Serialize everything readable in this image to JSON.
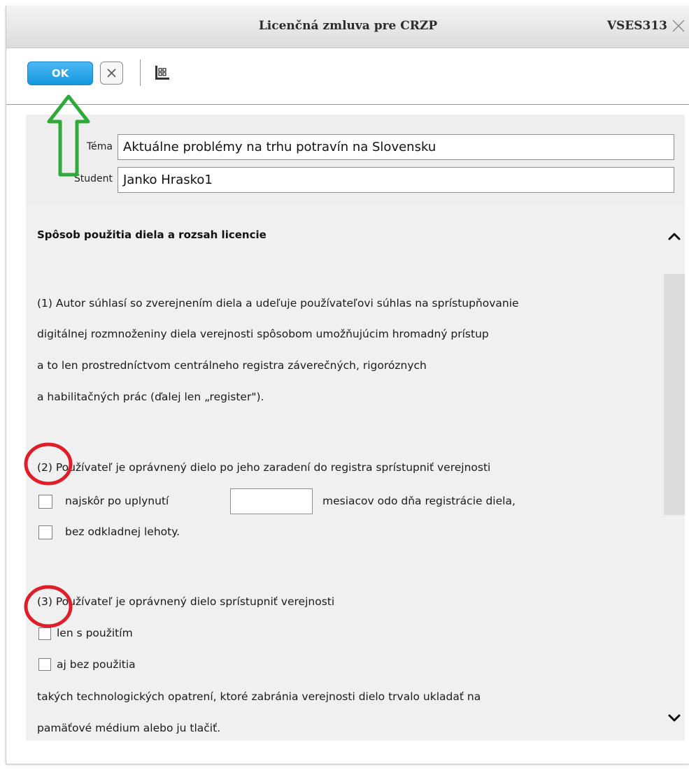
{
  "window": {
    "title": "Licenčná zmluva pre CRZP",
    "code": "VSES313",
    "close_icon": "close-icon"
  },
  "toolbar": {
    "ok_label": "OK",
    "cancel_icon": "close-icon",
    "grid_icon": "grid-icon"
  },
  "info": {
    "topic_label": "Téma",
    "topic_value": "Aktuálne problémy na trhu potravín na Slovensku",
    "student_label": "Študent",
    "student_value": "Janko Hrasko1"
  },
  "document": {
    "heading": "Spôsob použitia diela a rozsah licencie",
    "p1_lines": [
      "(1) Autor súhlasí so zverejnením diela a udeľuje používateľovi súhlas na sprístupňovanie",
      "digitálnej rozmnoženiny diela verejnosti spôsobom umožňujúcim hromadný prístup",
      "a to len prostredníctvom centrálneho registra záverečných, rigoróznych",
      "a habilitačných prác (ďalej len „register\")."
    ],
    "p2_intro": "(2) Používateľ je oprávnený dielo po jeho zaradení do registra sprístupniť verejnosti",
    "p2_option1_before": "najskôr po uplynutí",
    "p2_option1_after": "mesiacov odo dňa registrácie diela,",
    "p2_months_value": "",
    "p2_option2": "bez odkladnej lehoty.",
    "p3_intro": "(3) Používateľ je oprávnený dielo sprístupniť verejnosti",
    "p3_option1": "len s použitím",
    "p3_option2": "aj bez použitia",
    "p3_tail_lines": [
      "takých technologických opatrení, ktoré zabránia verejnosti dielo trvalo ukladať na",
      "pamäťové médium alebo ju tlačiť."
    ]
  },
  "scrollbar": {
    "up_icon": "chevron-up-icon",
    "down_icon": "chevron-down-icon"
  },
  "colors": {
    "ok_button": "#1fa3ec",
    "annotation_arrow": "#2eaa3a",
    "annotation_circle": "#e01e2a",
    "content_background": "#f0f0f0"
  }
}
